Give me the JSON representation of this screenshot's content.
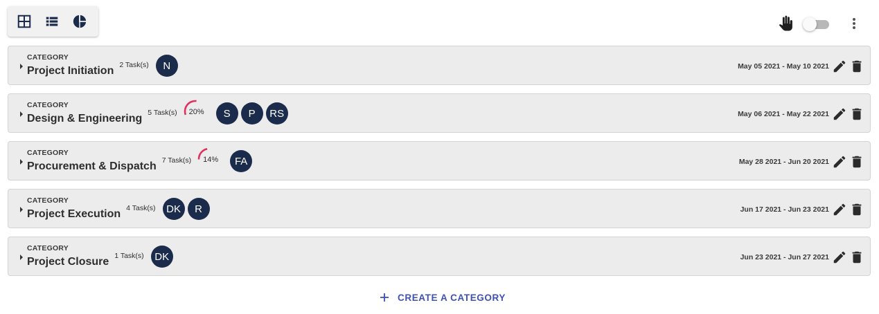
{
  "toolbar": {
    "views": [
      {
        "name": "grid-view-icon"
      },
      {
        "name": "list-view-icon"
      },
      {
        "name": "chart-view-icon"
      }
    ],
    "toggle_state": "off"
  },
  "categories": [
    {
      "label": "CATEGORY",
      "title": "Project Initiation",
      "tasks": "2 Task(s)",
      "progress": null,
      "assignees": [
        "N"
      ],
      "dates": "May 05 2021 - May 10 2021"
    },
    {
      "label": "CATEGORY",
      "title": "Design & Engineering",
      "tasks": "5 Task(s)",
      "progress": {
        "value": 20,
        "text": "20%"
      },
      "assignees": [
        "S",
        "P",
        "RS"
      ],
      "dates": "May 06 2021 - May 22 2021"
    },
    {
      "label": "CATEGORY",
      "title": "Procurement & Dispatch",
      "tasks": "7 Task(s)",
      "progress": {
        "value": 14,
        "text": "14%"
      },
      "assignees": [
        "FA"
      ],
      "dates": "May 28 2021 - Jun 20 2021"
    },
    {
      "label": "CATEGORY",
      "title": "Project Execution",
      "tasks": "4 Task(s)",
      "progress": null,
      "assignees": [
        "DK",
        "R"
      ],
      "dates": "Jun 17 2021 - Jun 23 2021"
    },
    {
      "label": "CATEGORY",
      "title": "Project Closure",
      "tasks": "1 Task(s)",
      "progress": null,
      "assignees": [
        "DK"
      ],
      "dates": "Jun 23 2021 - Jun 27 2021"
    }
  ],
  "create_button": {
    "label": "CREATE A CATEGORY"
  },
  "colors": {
    "avatar": "#1b2b4b",
    "progress_arc": "#e0325f",
    "accent": "#3f51b5",
    "row_bg": "#ececec"
  }
}
